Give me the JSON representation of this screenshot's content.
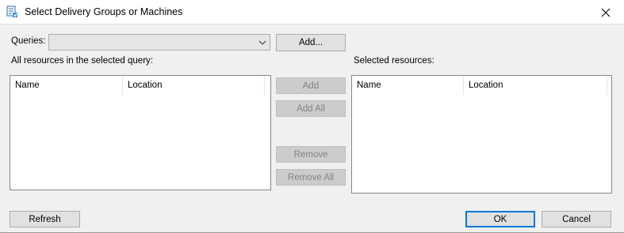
{
  "window": {
    "title": "Select Delivery Groups or Machines",
    "icon": "delivery-groups-icon",
    "close_icon": "close-icon"
  },
  "queries": {
    "label": "Queries:",
    "selected_value": "",
    "add_button": "Add..."
  },
  "left_panel": {
    "label": "All resources in the selected query:",
    "columns": [
      "Name",
      "Location"
    ],
    "rows": []
  },
  "right_panel": {
    "label": "Selected resources:",
    "columns": [
      "Name",
      "Location"
    ],
    "rows": []
  },
  "transfer_buttons": {
    "add": "Add",
    "add_all": "Add All",
    "remove": "Remove",
    "remove_all": "Remove All"
  },
  "footer": {
    "refresh": "Refresh",
    "ok": "OK",
    "cancel": "Cancel"
  },
  "colors": {
    "focus_accent": "#0078d7",
    "dialog_background": "#f0f0f0",
    "disabled_text": "#838383"
  }
}
